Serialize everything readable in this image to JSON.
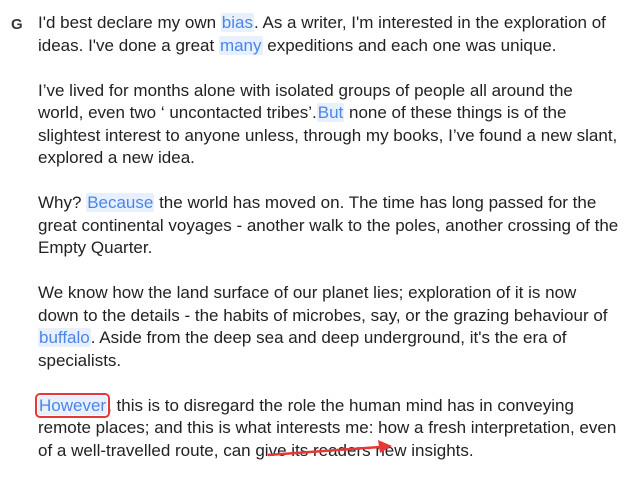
{
  "avatar": {
    "letter": "G"
  },
  "paragraphs": [
    {
      "parts": [
        {
          "text": "I'd best declare my own ",
          "hl": false
        },
        {
          "text": "bias",
          "hl": true
        },
        {
          "text": ". As a writer, I'm interested in the exploration of ideas. I've done a great ",
          "hl": false
        },
        {
          "text": "many",
          "hl": true
        },
        {
          "text": " expeditions and each one was unique.",
          "hl": false
        }
      ]
    },
    {
      "parts": [
        {
          "text": "I’ve lived for months alone with isolated groups of people all around the world, even two ‘ uncontacted tribes’.",
          "hl": false
        },
        {
          "text": "But",
          "hl": true
        },
        {
          "text": " none of these things is of the slightest interest to anyone unless, through my books, I’ve found a new slant, explored a new idea.",
          "hl": false
        }
      ]
    },
    {
      "parts": [
        {
          "text": "Why? ",
          "hl": false
        },
        {
          "text": "Because",
          "hl": true
        },
        {
          "text": " the world has moved on. The time has long passed for the great continental voyages - another walk to the poles, another crossing of the Empty Quarter.",
          "hl": false
        }
      ]
    },
    {
      "parts": [
        {
          "text": "We know how the land surface of our planet lies; exploration of it is now down to the details - the habits of microbes, say, or the grazing behaviour of ",
          "hl": false
        },
        {
          "text": "buffalo",
          "hl": true
        },
        {
          "text": ". Aside from the deep sea and deep underground, it's the era of specialists.",
          "hl": false
        }
      ]
    },
    {
      "parts": [
        {
          "text": "However",
          "hl": true,
          "boxed": true
        },
        {
          "text": ", this is to disregard the role the human mind has in conveying remote places; and this is what interests me: how a fresh interpretation, even of a well-travelled route, can give its readers new insights.",
          "hl": false
        }
      ]
    }
  ],
  "colors": {
    "highlight_bg": "#e8f0fe",
    "highlight_text": "#4a86e8",
    "annotation": "#e53935"
  },
  "icons": {
    "annotation": "red-arrow-icon"
  }
}
